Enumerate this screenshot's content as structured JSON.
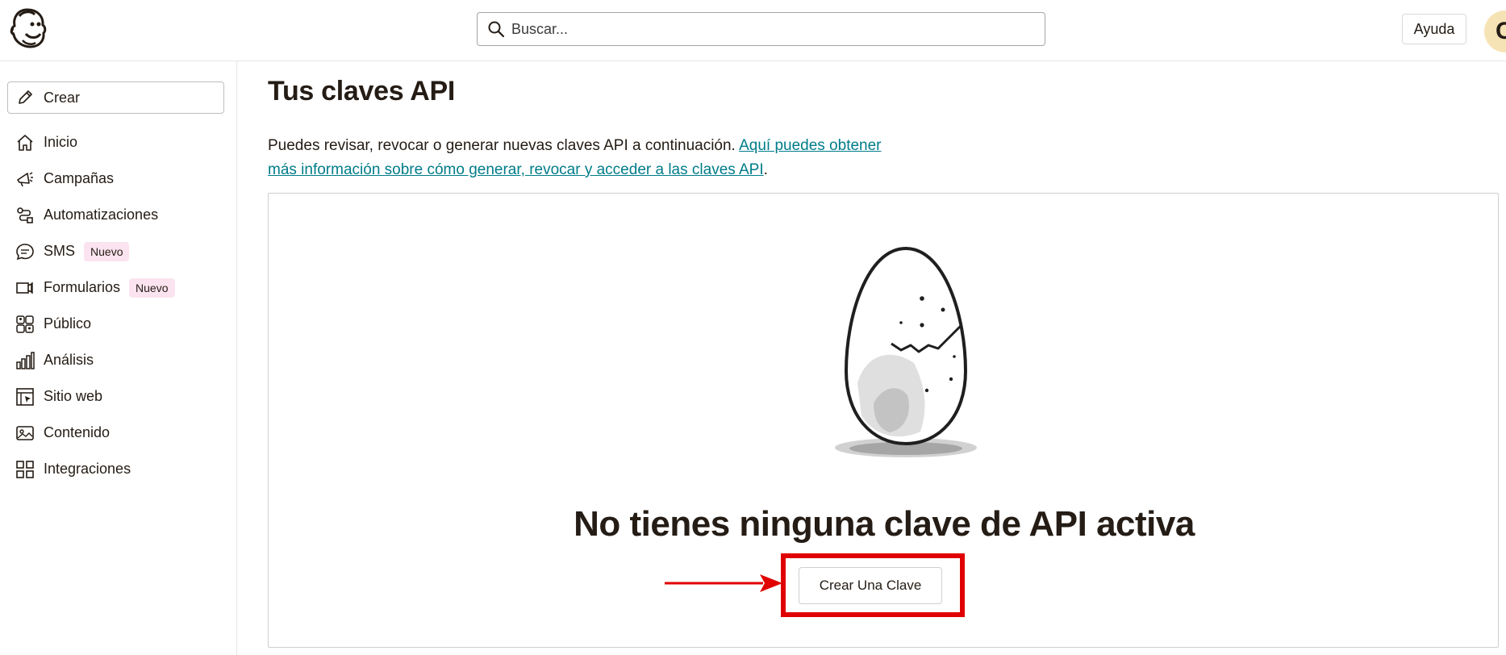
{
  "header": {
    "logo_icon": "mailchimp-freddie-logo-icon",
    "search_placeholder": "Buscar...",
    "help_label": "Ayuda",
    "avatar_initial": "C"
  },
  "sidebar": {
    "create_label": "Crear",
    "items": [
      {
        "label": "Inicio",
        "icon": "home-icon"
      },
      {
        "label": "Campañas",
        "icon": "megaphone-icon"
      },
      {
        "label": "Automatizaciones",
        "icon": "automation-flow-icon"
      },
      {
        "label": "SMS",
        "icon": "chat-bubble-icon",
        "badge": "Nuevo"
      },
      {
        "label": "Formularios",
        "icon": "form-icon",
        "badge": "Nuevo"
      },
      {
        "label": "Público",
        "icon": "audience-icon"
      },
      {
        "label": "Análisis",
        "icon": "bar-chart-icon"
      },
      {
        "label": "Sitio web",
        "icon": "website-icon"
      },
      {
        "label": "Contenido",
        "icon": "content-icon"
      },
      {
        "label": "Integraciones",
        "icon": "integrations-grid-icon"
      }
    ]
  },
  "main": {
    "title": "Tus claves API",
    "intro_text": "Puedes revisar, revocar o generar nuevas claves API a continuación. ",
    "intro_link": "Aquí puedes obtener más información sobre cómo generar, revocar y acceder a las claves API",
    "intro_end": ".",
    "empty_state": {
      "illustration": "cracked-egg-illustration",
      "title": "No tienes ninguna clave de API activa",
      "cta_label": "Crear Una Clave"
    }
  },
  "annotations": {
    "highlight_color": "#e00000"
  },
  "colors": {
    "link": "#007c89",
    "badge_bg": "#fbe3ef",
    "text": "#241c15"
  }
}
